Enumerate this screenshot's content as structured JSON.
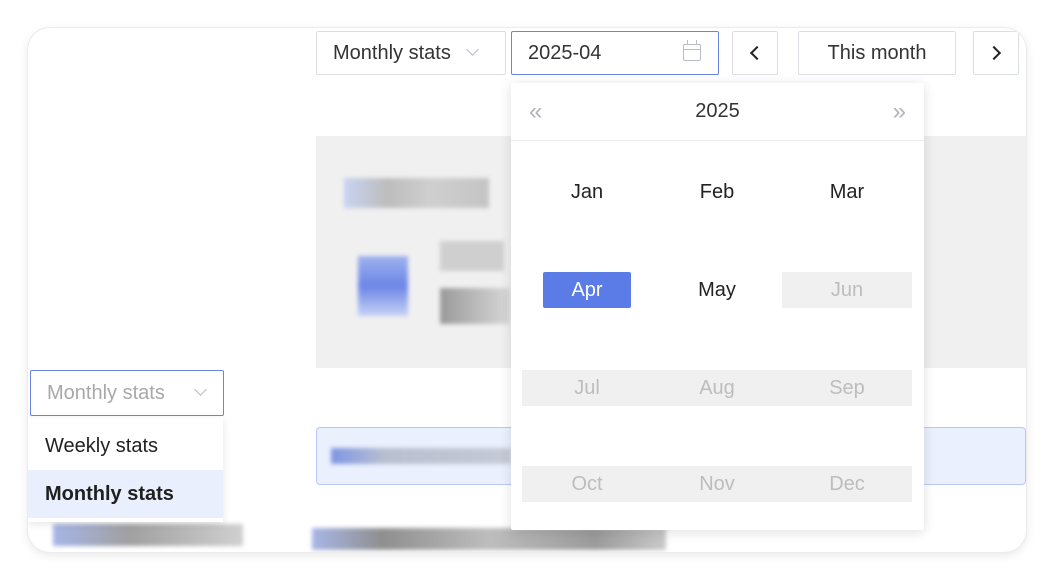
{
  "toolbar": {
    "stats_select_value": "Monthly stats",
    "date_value": "2025-04",
    "this_month_label": "This month"
  },
  "left_select": {
    "value": "Monthly stats",
    "options": [
      "Weekly stats",
      "Monthly stats"
    ],
    "selected": "Monthly stats"
  },
  "month_picker": {
    "year": "2025",
    "prev_year_glyph": "«",
    "next_year_glyph": "»",
    "months": [
      {
        "label": "Jan",
        "state": "normal"
      },
      {
        "label": "Feb",
        "state": "normal"
      },
      {
        "label": "Mar",
        "state": "normal"
      },
      {
        "label": "Apr",
        "state": "selected"
      },
      {
        "label": "May",
        "state": "normal"
      },
      {
        "label": "Jun",
        "state": "disabled"
      },
      {
        "label": "Jul",
        "state": "disabled"
      },
      {
        "label": "Aug",
        "state": "disabled"
      },
      {
        "label": "Sep",
        "state": "disabled"
      },
      {
        "label": "Oct",
        "state": "disabled"
      },
      {
        "label": "Nov",
        "state": "disabled"
      },
      {
        "label": "Dec",
        "state": "disabled"
      }
    ]
  },
  "colors": {
    "accent": "#5b7be7",
    "input_focus_border": "#6b84e4",
    "selected_menu_bg": "#e9effd",
    "disabled_cell_bg": "#f0f0f0"
  },
  "icons": [
    "chevron-down-icon",
    "calendar-icon",
    "chevron-left-icon",
    "chevron-right-icon",
    "double-chevron-left-icon",
    "double-chevron-right-icon"
  ]
}
